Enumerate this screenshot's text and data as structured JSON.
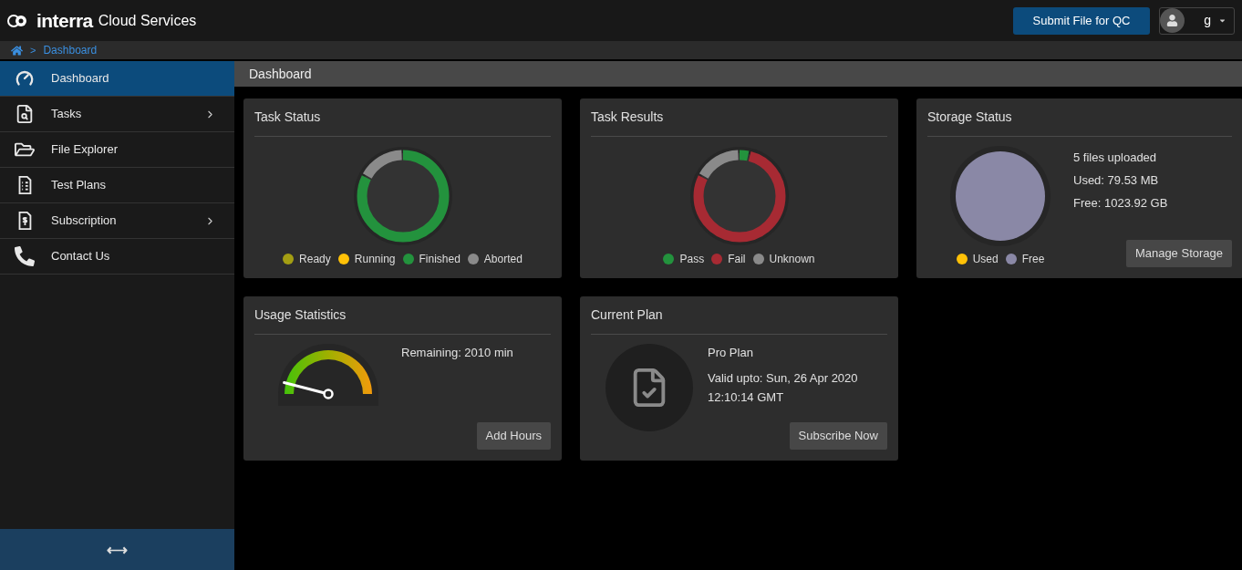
{
  "header": {
    "brand": "interra",
    "product": "Cloud Services",
    "submit_button": "Submit File for QC",
    "user": "g"
  },
  "breadcrumb": {
    "separator": ">",
    "items": [
      "Dashboard"
    ]
  },
  "sidebar": {
    "items": [
      {
        "label": "Dashboard",
        "selected": true,
        "has_submenu": false
      },
      {
        "label": "Tasks",
        "selected": false,
        "has_submenu": true
      },
      {
        "label": "File Explorer",
        "selected": false,
        "has_submenu": false
      },
      {
        "label": "Test Plans",
        "selected": false,
        "has_submenu": false
      },
      {
        "label": "Subscription",
        "selected": false,
        "has_submenu": true
      },
      {
        "label": "Contact Us",
        "selected": false,
        "has_submenu": false
      }
    ],
    "toggle": "⟷"
  },
  "page_title": "Dashboard",
  "task_status": {
    "title": "Task Status",
    "legend": [
      {
        "label": "Ready",
        "color": "#a39e13"
      },
      {
        "label": "Running",
        "color": "#ffc107"
      },
      {
        "label": "Finished",
        "color": "#23923d"
      },
      {
        "label": "Aborted",
        "color": "#8a8a8a"
      }
    ]
  },
  "task_results": {
    "title": "Task Results",
    "legend": [
      {
        "label": "Pass",
        "color": "#23923d"
      },
      {
        "label": "Fail",
        "color": "#a72a33"
      },
      {
        "label": "Unknown",
        "color": "#8a8a8a"
      }
    ]
  },
  "storage_status": {
    "title": "Storage Status",
    "lines": [
      "5 files uploaded",
      "Used: 79.53 MB",
      "Free: 1023.92 GB"
    ],
    "legend": [
      {
        "label": "Used",
        "color": "#ffc107"
      },
      {
        "label": "Free",
        "color": "#8a88a6"
      }
    ],
    "button": "Manage Storage"
  },
  "usage_statistics": {
    "title": "Usage Statistics",
    "level": 0.08,
    "remaining": "Remaining: 2010 min",
    "button": "Add Hours"
  },
  "current_plan": {
    "title": "Current Plan",
    "plan": "Pro Plan",
    "valid_upto": "Valid upto: Sun, 26 Apr 2020",
    "time": "12:10:14 GMT",
    "button": "Subscribe Now"
  }
}
